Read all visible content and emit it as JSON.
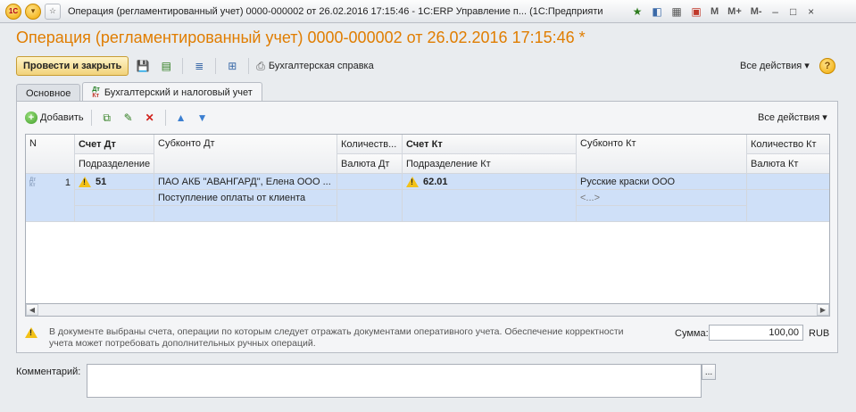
{
  "window": {
    "title": "Операция (регламентированный учет) 0000-000002 от 26.02.2016 17:15:46 - 1С:ERP Управление п... (1С:Предприятие)",
    "logo_text": "1С",
    "menu_M": "M",
    "menu_Mplus": "M+",
    "menu_Mminus": "M-",
    "minimize": "–",
    "maximize": "□",
    "close": "×"
  },
  "form": {
    "title": "Операция (регламентированный учет) 0000-000002 от 26.02.2016 17:15:46 *"
  },
  "toolbar": {
    "post_close_label": "Провести и закрыть",
    "report_label": "Бухгалтерская справка",
    "all_actions_label": "Все действия ▾",
    "help": "?"
  },
  "tabs": [
    {
      "label": "Основное"
    },
    {
      "label": "Бухгалтерский и налоговый учет",
      "icon_top": "Дт",
      "icon_bottom": "Кт"
    }
  ],
  "table_toolbar": {
    "add_label": "Добавить",
    "all_actions_label": "Все действия ▾"
  },
  "table": {
    "headers": {
      "n": "N",
      "account_dt": "Счет Дт",
      "subconto_dt": "Субконто Дт",
      "qty_dt": "Количеств...",
      "account_kt": "Счет Кт",
      "subconto_kt": "Субконто Кт",
      "qty_kt": "Количество Кт",
      "division_dt": "Подразделение",
      "currency_dt": "Валюта Дт",
      "division_kt": "Подразделение Кт",
      "currency_kt": "Валюта Кт"
    },
    "rows": [
      {
        "n": "1",
        "account_dt": "51",
        "subconto_dt_1": "ПАО АКБ \"АВАНГАРД\", Елена ООО ...",
        "subconto_dt_2": "Поступление оплаты от клиента",
        "account_kt": "62.01",
        "subconto_kt_1": "Русские краски ООО",
        "subconto_kt_2": "<...>",
        "icon_top": "Дт",
        "icon_bottom": "Кт"
      }
    ]
  },
  "footer": {
    "warning_text": "В документе выбраны счета, операции по которым следует отражать документами оперативного учета. Обеспечение корректности учета может потребовать дополнительных ручных операций.",
    "sum_label": "Сумма:",
    "sum_value": "100,00",
    "currency": "RUB",
    "comment_label": "Комментарий:",
    "comment_value": "",
    "comment_button": "..."
  }
}
